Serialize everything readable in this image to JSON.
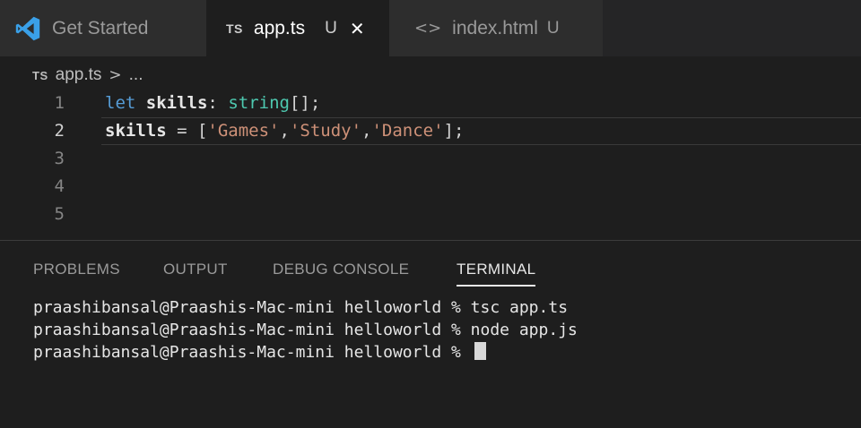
{
  "tabs": {
    "get_started": {
      "label": "Get Started",
      "icon": "vscode-logo-icon"
    },
    "app_ts": {
      "badge": "TS",
      "label": "app.ts",
      "modified": "U",
      "close": "✕"
    },
    "index_html": {
      "glyph": "<>",
      "label": "index.html",
      "modified": "U"
    }
  },
  "breadcrumb": {
    "badge": "TS",
    "file": "app.ts",
    "separator": ">",
    "rest": "..."
  },
  "editor": {
    "line_numbers": [
      "1",
      "2",
      "3",
      "4",
      "5"
    ],
    "line1": {
      "kw": "let",
      "id": "skills",
      "colon": ":",
      "type": "string",
      "tail": "[];"
    },
    "line2": {
      "id": "skills",
      "assign": " = [",
      "s1": "'Games'",
      "c1": ",",
      "s2": "'Study'",
      "c2": ",",
      "s3": "'Dance'",
      "tail": "];"
    }
  },
  "panel": {
    "tabs": [
      "PROBLEMS",
      "OUTPUT",
      "DEBUG CONSOLE",
      "TERMINAL"
    ],
    "terminal_lines": [
      "praashibansal@Praashis-Mac-mini helloworld % tsc app.ts",
      "praashibansal@Praashis-Mac-mini helloworld % node app.js",
      "praashibansal@Praashis-Mac-mini helloworld % "
    ]
  },
  "colors": {
    "accent": "#569cd6",
    "type": "#4ec9b0",
    "string": "#ce9178",
    "background": "#1e1e1e"
  }
}
